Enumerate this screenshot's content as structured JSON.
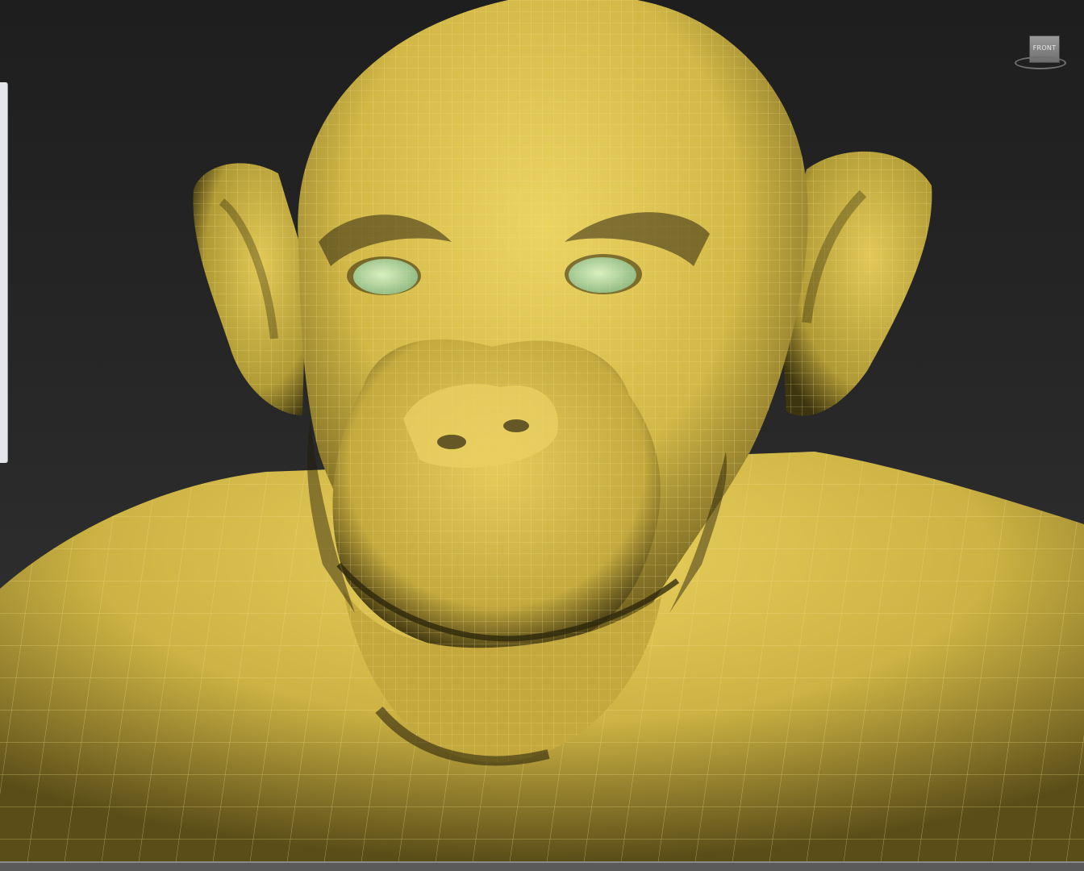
{
  "viewport": {
    "view_label": "FRONT",
    "icons": {
      "viewcube": "viewcube-icon"
    }
  },
  "colors": {
    "model_base": "#d9c24f",
    "model_shadow": "#3a3210",
    "wire": "#f3e28a",
    "eye": "#b8dca0"
  }
}
